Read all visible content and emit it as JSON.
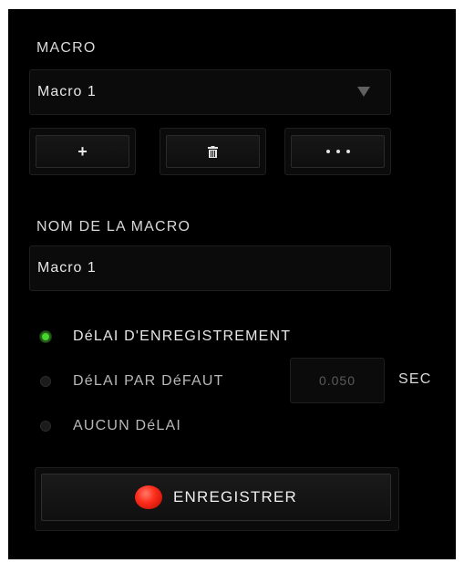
{
  "macro_section": {
    "title": "MACRO",
    "selected_macro": "Macro 1",
    "buttons": {
      "add": "+",
      "delete_icon": "trash-icon",
      "more_icon": "more-dots-icon"
    }
  },
  "name_section": {
    "title": "NOM DE LA MACRO",
    "value": "Macro 1"
  },
  "delay_options": {
    "record": {
      "label": "DéLAI D'ENREGISTREMENT",
      "selected": true
    },
    "default": {
      "label": "DéLAI PAR DéFAUT",
      "selected": false,
      "value": "0.050",
      "unit": "SEC"
    },
    "none": {
      "label": "AUCUN DéLAI",
      "selected": false
    }
  },
  "record_button": {
    "label": "ENREGISTRER"
  },
  "colors": {
    "accent_green": "#44d62c",
    "record_red": "#ff2d1c",
    "panel_bg": "#000000"
  }
}
